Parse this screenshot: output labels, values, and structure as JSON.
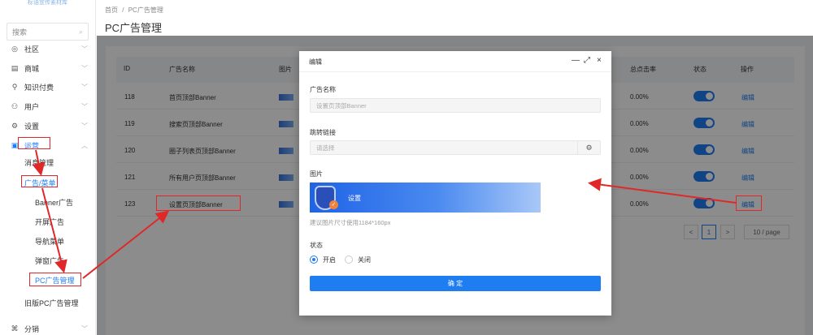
{
  "sidebar": {
    "logo_text": "标语宣传素材库",
    "search_placeholder": "搜索",
    "items": [
      {
        "label": "社区",
        "icon": "chat-icon"
      },
      {
        "label": "商城",
        "icon": "shop-icon"
      },
      {
        "label": "知识付费",
        "icon": "location-icon"
      },
      {
        "label": "用户",
        "icon": "user-icon"
      },
      {
        "label": "设置",
        "icon": "gear-icon"
      },
      {
        "label": "运营",
        "icon": "monitor-icon"
      }
    ],
    "sub_items": {
      "msg": "消息管理",
      "ad_menu": "广告/菜单",
      "banner": "Banner广告",
      "splash": "开屏广告",
      "nav": "导航菜单",
      "popup": "弹窗广告",
      "pc_ad": "PC广告管理",
      "old_pc_ad": "旧版PC广告管理",
      "distribution": "分销"
    }
  },
  "header": {
    "breadcrumb_home": "首页",
    "breadcrumb_sep": "/",
    "breadcrumb_current": "PC广告管理",
    "title": "PC广告管理"
  },
  "table": {
    "columns": {
      "id": "ID",
      "name": "广告名称",
      "image": "图片",
      "ctr": "总点击率",
      "status": "状态",
      "action": "操作"
    },
    "rows": [
      {
        "id": "118",
        "name": "首页顶部Banner",
        "ctr": "0.00%",
        "action": "编辑"
      },
      {
        "id": "119",
        "name": "搜索页顶部Banner",
        "ctr": "0.00%",
        "action": "编辑"
      },
      {
        "id": "120",
        "name": "圈子列表页顶部Banner",
        "ctr": "0.00%",
        "action": "编辑"
      },
      {
        "id": "121",
        "name": "所有用户页顶部Banner",
        "ctr": "0.00%",
        "action": "编辑"
      },
      {
        "id": "123",
        "name": "设置页顶部Banner",
        "ctr": "0.00%",
        "action": "编辑"
      }
    ],
    "pager": {
      "prev": "<",
      "page": "1",
      "next": ">",
      "page_size": "10 / page"
    }
  },
  "modal": {
    "title": "编辑",
    "ctrl_min": "—",
    "ctrl_max": "⤢",
    "ctrl_close": "×",
    "name_label": "广告名称",
    "name_value": "设置页顶部Banner",
    "link_label": "跳转链接",
    "link_placeholder": "请选择",
    "image_label": "图片",
    "banner_text": "设置",
    "image_hint": "建议图片尺寸使用1184*160px",
    "status_label": "状态",
    "status_on": "开启",
    "status_off": "关闭",
    "confirm": "确 定"
  },
  "colors": {
    "accent": "#1f7df2",
    "annotation": "#e02828"
  }
}
